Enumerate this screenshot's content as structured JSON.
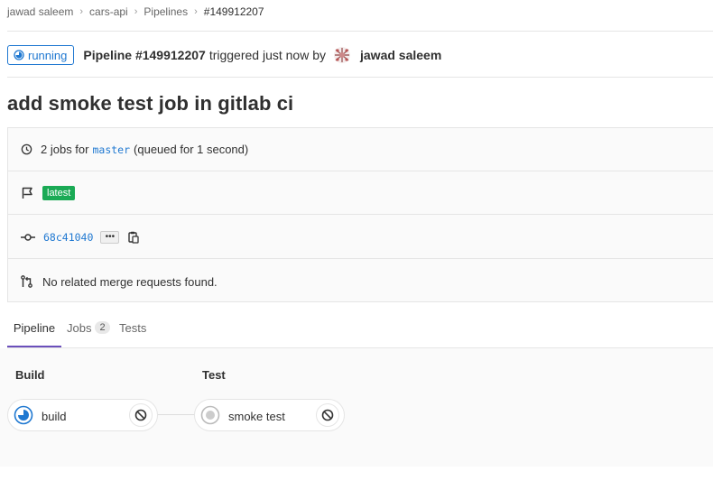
{
  "breadcrumb": [
    "jawad saleem",
    "cars-api",
    "Pipelines",
    "#149912207"
  ],
  "header": {
    "status": "running",
    "pipeline": "Pipeline #149912207",
    "triggered_text": "triggered just now by",
    "user": "jawad saleem"
  },
  "title": "add smoke test job in gitlab ci",
  "info": {
    "jobs_prefix": "2 jobs for",
    "branch": "master",
    "queued": "(queued for 1 second)",
    "latest_badge": "latest",
    "commit_sha": "68c41040",
    "ellipsis": "•••",
    "merge_requests": "No related merge requests found."
  },
  "tabs": [
    {
      "label": "Pipeline"
    },
    {
      "label": "Jobs",
      "count": "2"
    },
    {
      "label": "Tests"
    }
  ],
  "stages": [
    {
      "title": "Build",
      "job": "build",
      "status": "running"
    },
    {
      "title": "Test",
      "job": "smoke test",
      "status": "created"
    }
  ],
  "colors": {
    "accent_blue": "#1f78d1",
    "success_green": "#1aaa55",
    "tab_active": "#6b4fbb"
  },
  "icons": [
    "running-status-icon",
    "avatar",
    "clock-icon",
    "flag-icon",
    "commit-icon",
    "clipboard-icon",
    "merge-request-icon",
    "cancel-icon",
    "created-status-icon"
  ]
}
